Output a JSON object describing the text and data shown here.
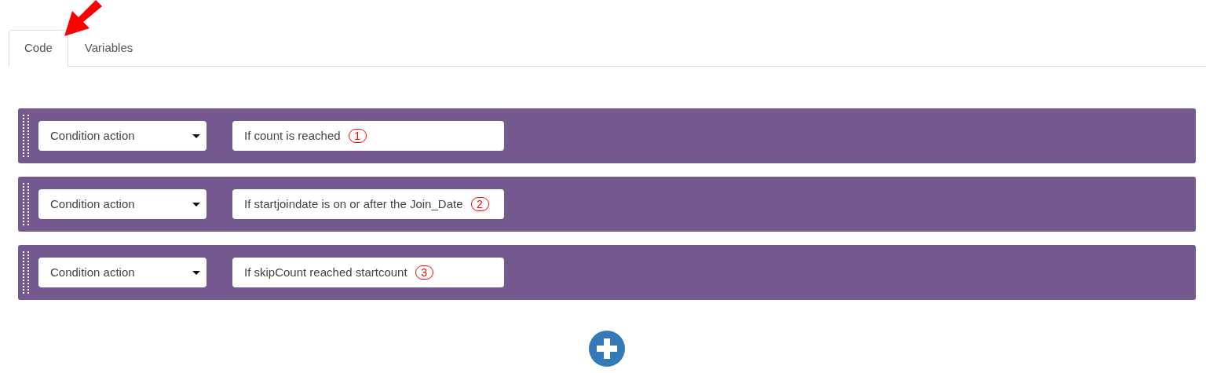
{
  "tabs": [
    {
      "label": "Code",
      "selected": true
    },
    {
      "label": "Variables",
      "selected": false
    }
  ],
  "actions": [
    {
      "type": "Condition action",
      "condition": "If count is reached",
      "annotation": "1"
    },
    {
      "type": "Condition action",
      "condition": "If startjoindate is on or after the Join_Date",
      "annotation": "2"
    },
    {
      "type": "Condition action",
      "condition": "If skipCount reached startcount",
      "annotation": "3"
    }
  ]
}
